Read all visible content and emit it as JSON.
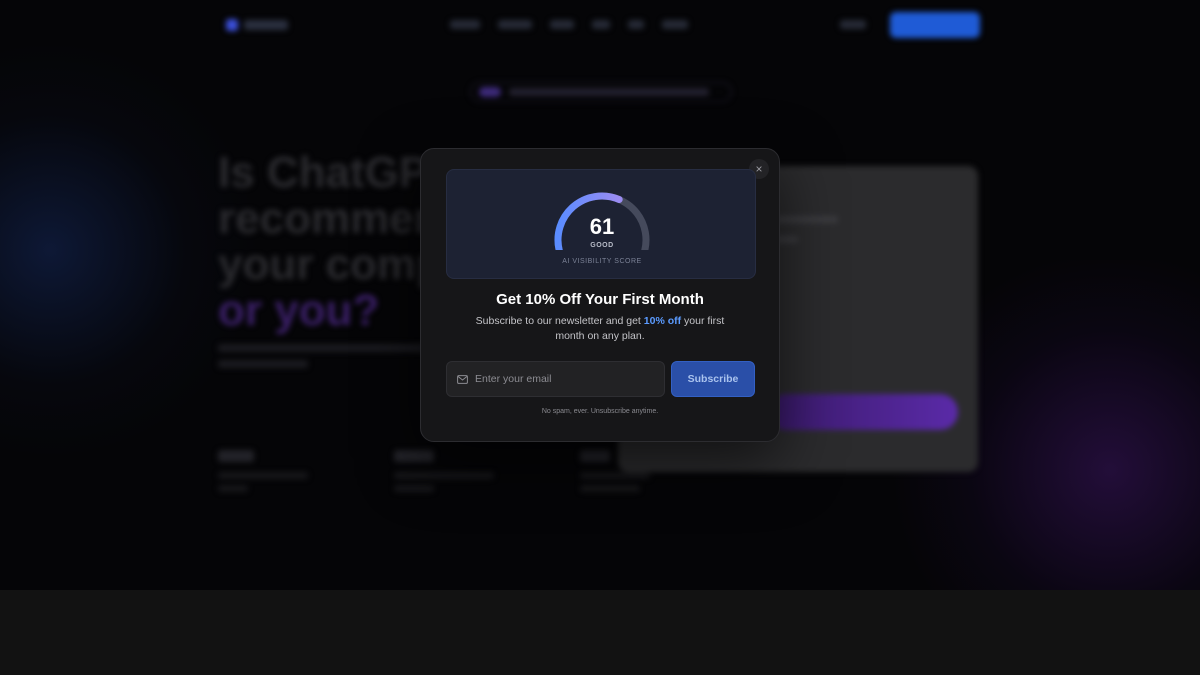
{
  "background": {
    "headline_lines": [
      "Is ChatGPT",
      "recommending",
      "your company",
      "or you?"
    ]
  },
  "modal": {
    "close_label": "×",
    "score": {
      "value": "61",
      "grade": "GOOD",
      "caption": "AI VISIBILITY SCORE",
      "fraction": 0.61
    },
    "title": "Get 10% Off Your First Month",
    "description_pre": "Subscribe to our newsletter and get ",
    "description_highlight": "10% off",
    "description_post": " your first month on any plan.",
    "email_placeholder": "Enter your email",
    "subscribe_label": "Subscribe",
    "note": "No spam, ever. Unsubscribe anytime."
  },
  "icons": {
    "email": "mail-icon",
    "close": "close-icon"
  },
  "colors": {
    "accent": "#5b9bff",
    "button": "#2a4fa8",
    "gauge_start": "#5a8cff",
    "gauge_end": "#9b8cf2",
    "gauge_track": "#454a5c"
  }
}
